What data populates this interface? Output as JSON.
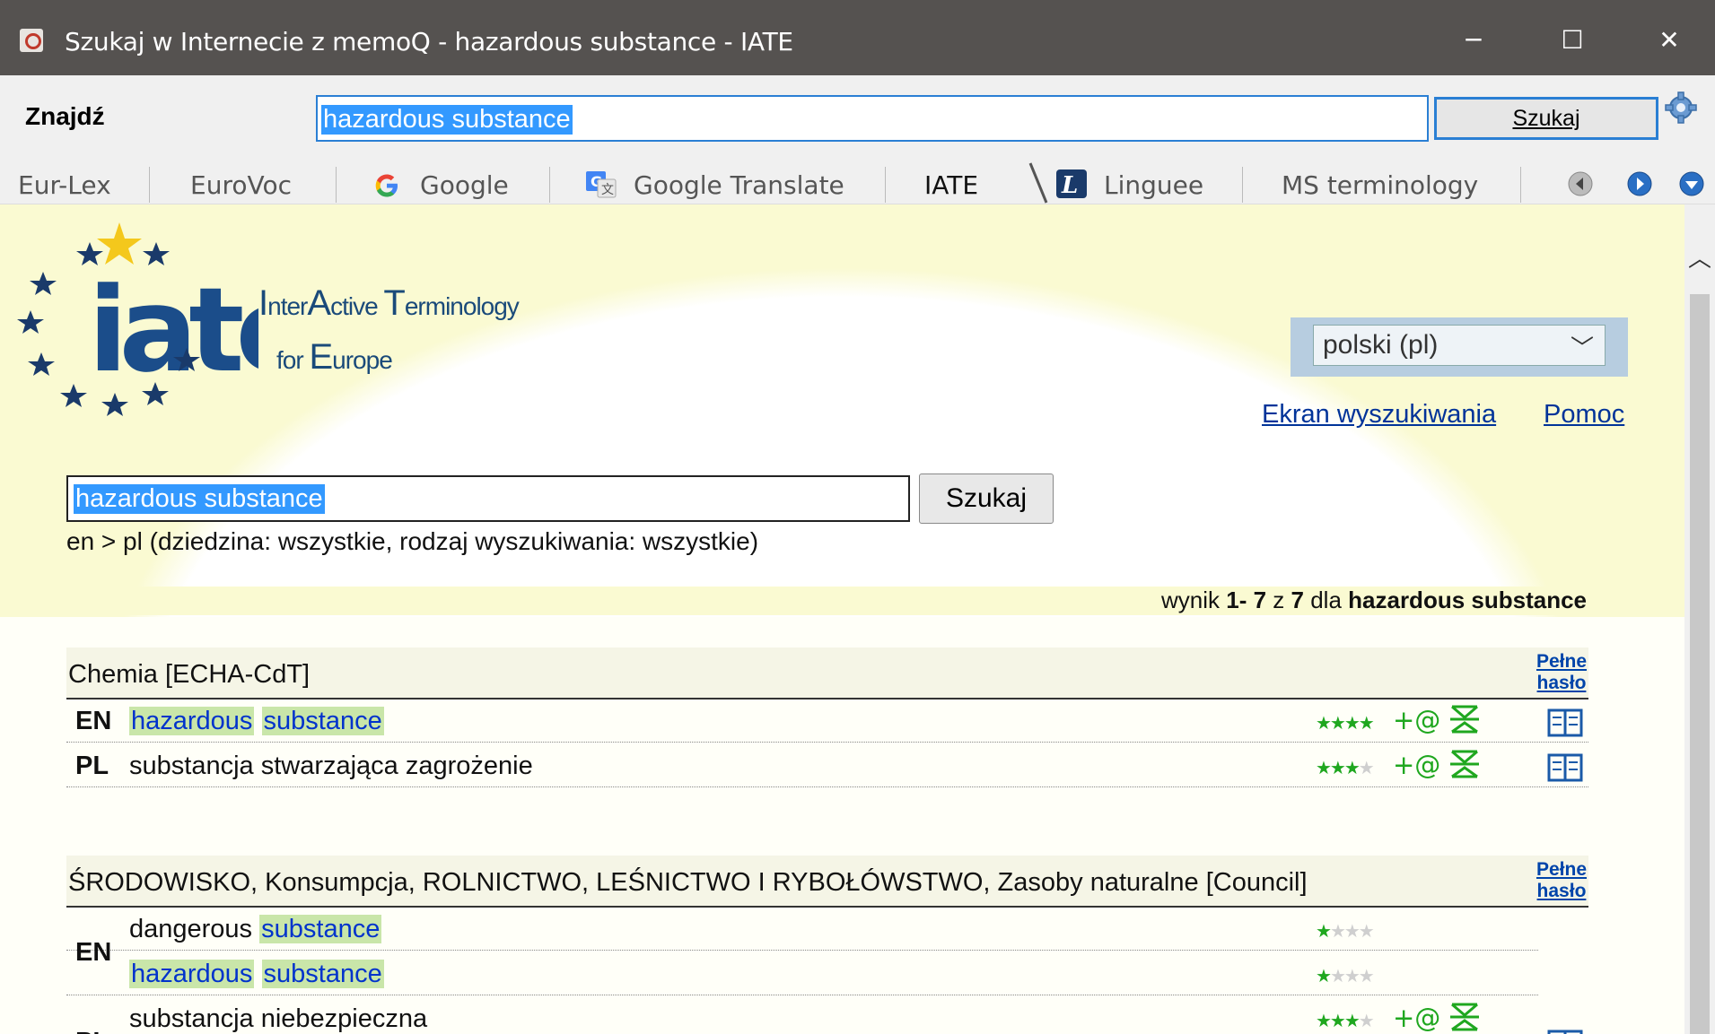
{
  "window": {
    "title": "Szukaj w Internecie z memoQ - hazardous substance - IATE",
    "minimize": "─",
    "maximize": "☐",
    "close": "✕"
  },
  "findbar": {
    "label": "Znajdź",
    "query": "hazardous substance",
    "search_button": "Szukaj"
  },
  "tabs": [
    {
      "label": "Eur-Lex"
    },
    {
      "label": "EuroVoc"
    },
    {
      "label": "Google"
    },
    {
      "label": "Google Translate"
    },
    {
      "label": "IATE"
    },
    {
      "label": "Linguee"
    },
    {
      "label": "MS terminology"
    }
  ],
  "iate": {
    "logo_line1": [
      "I",
      "nter",
      "A",
      "ctive ",
      "T",
      "erminology"
    ],
    "logo_line2": [
      "for ",
      "E",
      "urope"
    ],
    "language_selected": "polski (pl)",
    "links": [
      "Ekran wyszukiwania",
      "Pomoc"
    ],
    "search_value": "hazardous substance",
    "search_button": "Szukaj",
    "search_info": "en > pl (dziedzina: wszystkie, rodzaj wyszukiwania: wszystkie)",
    "results_prefix": "wynik ",
    "results_range": "1- 7",
    "results_of": " z ",
    "results_total": "7",
    "results_for": " dla ",
    "results_query": "hazardous substance",
    "full_entry_line1": "Pełne",
    "full_entry_line2": "hasło"
  },
  "entries": [
    {
      "domain": "Chemia [ECHA-CdT]",
      "rows": [
        {
          "lang": "EN",
          "term_parts": [
            "hazardous",
            "substance"
          ],
          "stars": 4
        },
        {
          "lang": "PL",
          "term": "substancja stwarzająca zagrożenie",
          "stars": 3
        }
      ]
    },
    {
      "domain": "ŚRODOWISKO, Konsumpcja, ROLNICTWO, LEŚNICTWO I RYBOŁÓWSTWO, Zasoby naturalne [Council]",
      "rows": [
        {
          "lang": "EN",
          "term_prefix": "dangerous ",
          "term_parts": [
            "substance"
          ],
          "stars": 1
        },
        {
          "lang": "",
          "term_parts": [
            "hazardous",
            "substance"
          ],
          "stars": 1
        },
        {
          "lang": "PL",
          "term": "substancja niebezpieczna",
          "stars": 3
        }
      ]
    }
  ],
  "colors": {
    "titlebar": "#555250",
    "accent": "#2a7fd4",
    "highlight": "#c9e6a9",
    "star_on": "#1fa71f",
    "banner": "#fafad2"
  }
}
